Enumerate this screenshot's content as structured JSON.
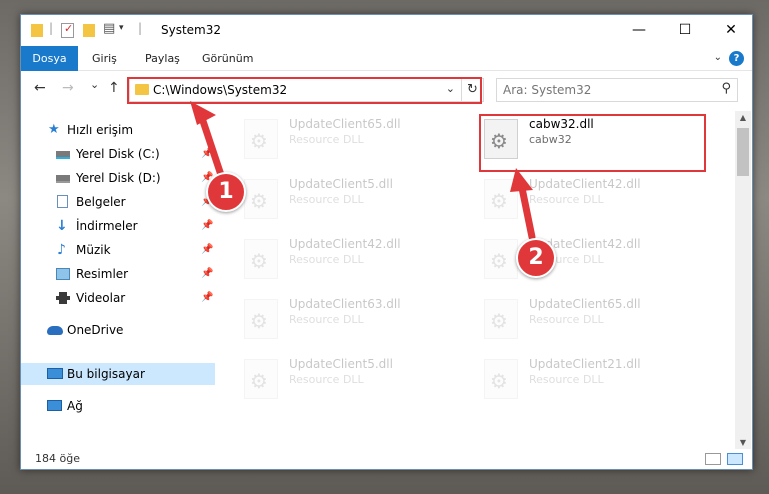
{
  "window": {
    "title": "System32",
    "controls": {
      "minimize": "—",
      "maximize": "☐",
      "close": "✕"
    }
  },
  "ribbon": {
    "tabs": [
      "Dosya",
      "Giriş",
      "Paylaş",
      "Görünüm"
    ],
    "active_tab": "Dosya",
    "help": "?"
  },
  "navbar": {
    "back": "←",
    "forward": "→",
    "recent": "⌄",
    "up": "↑",
    "address_path": "C:\\Windows\\System32",
    "refresh": "↻",
    "search_placeholder": "Ara: System32"
  },
  "sidebar": {
    "items": [
      {
        "label": "Hızlı erişim",
        "icon": "star-icon",
        "pinned": false
      },
      {
        "label": "Yerel Disk (C:)",
        "icon": "drive-icon",
        "pinned": true
      },
      {
        "label": "Yerel Disk (D:)",
        "icon": "drive-icon",
        "pinned": true
      },
      {
        "label": "Belgeler",
        "icon": "documents-icon",
        "pinned": true
      },
      {
        "label": "İndirmeler",
        "icon": "downloads-icon",
        "pinned": true
      },
      {
        "label": "Müzik",
        "icon": "music-icon",
        "pinned": true
      },
      {
        "label": "Resimler",
        "icon": "pictures-icon",
        "pinned": true
      },
      {
        "label": "Videolar",
        "icon": "videos-icon",
        "pinned": true
      },
      {
        "label": "OneDrive",
        "icon": "cloud-icon",
        "pinned": false
      },
      {
        "label": "Bu bilgisayar",
        "icon": "computer-icon",
        "pinned": false,
        "selected": true
      },
      {
        "label": "Ağ",
        "icon": "network-icon",
        "pinned": false
      }
    ]
  },
  "files": {
    "highlighted": {
      "name": "cabw32.dll",
      "type": "cabw32"
    },
    "background": [
      {
        "name": "UpdateClient65.dll",
        "type": "Resource DLL"
      },
      {
        "name": "UpdateClient5.dll",
        "type": "Resource DLL"
      },
      {
        "name": "UpdateClient42.dll",
        "type": "Resource DLL"
      },
      {
        "name": "UpdateClient42.dll",
        "type": "Resource DLL"
      },
      {
        "name": "UpdateClient42.dll",
        "type": "Resource DLL"
      },
      {
        "name": "UpdateClient63.dll",
        "type": "Resource DLL"
      },
      {
        "name": "UpdateClient65.dll",
        "type": "Resource DLL"
      },
      {
        "name": "UpdateClient5.dll",
        "type": "Resource DLL"
      },
      {
        "name": "UpdateClient21.dll",
        "type": "Resource DLL"
      }
    ]
  },
  "status": {
    "count": "184 öğe"
  },
  "annotations": {
    "callout_1": "1",
    "callout_2": "2",
    "color": "#e0383a"
  }
}
